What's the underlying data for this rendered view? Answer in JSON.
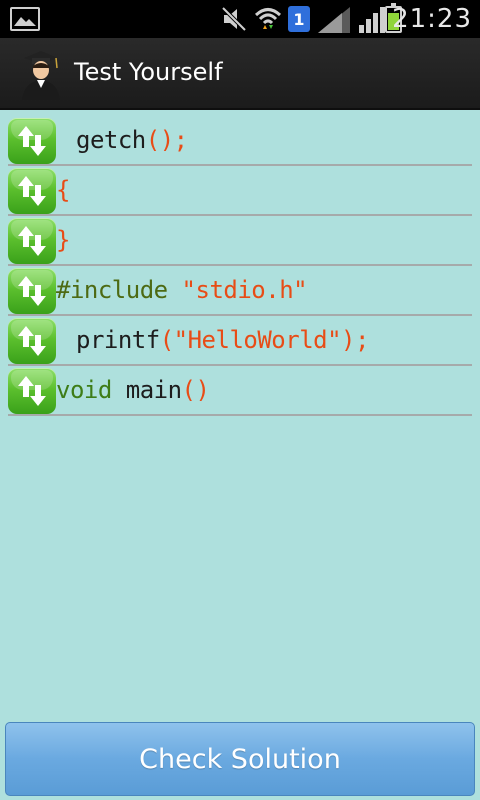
{
  "status_bar": {
    "time": "21:23",
    "sim_slot": "1",
    "icons": [
      "gallery-icon",
      "mute-icon",
      "wifi-icon",
      "sim-badge",
      "signal-icon",
      "battery-icon"
    ],
    "battery_level": 0.75
  },
  "action_bar": {
    "title": "Test Yourself",
    "icon": "graduate-avatar-icon"
  },
  "code_lines": [
    {
      "indent": true,
      "tokens": [
        {
          "text": "getch",
          "color": "black"
        },
        {
          "text": "();",
          "color": "red"
        }
      ]
    },
    {
      "indent": false,
      "tokens": [
        {
          "text": "{",
          "color": "red"
        }
      ]
    },
    {
      "indent": false,
      "tokens": [
        {
          "text": "}",
          "color": "red"
        }
      ]
    },
    {
      "indent": false,
      "tokens": [
        {
          "text": "#include ",
          "color": "olive"
        },
        {
          "text": "\"stdio.h\"",
          "color": "red"
        }
      ]
    },
    {
      "indent": true,
      "tokens": [
        {
          "text": "printf",
          "color": "black"
        },
        {
          "text": "(\"HelloWorld\");",
          "color": "red"
        }
      ]
    },
    {
      "indent": false,
      "tokens": [
        {
          "text": "void ",
          "color": "green"
        },
        {
          "text": "main",
          "color": "black"
        },
        {
          "text": "()",
          "color": "red"
        }
      ]
    }
  ],
  "colors": {
    "background": "#aee0dd",
    "handle": "#5cc02e",
    "token_red": "#e84c16",
    "token_green": "#3e7d17",
    "button": "#6aa9e0"
  },
  "check_button_label": "Check Solution"
}
